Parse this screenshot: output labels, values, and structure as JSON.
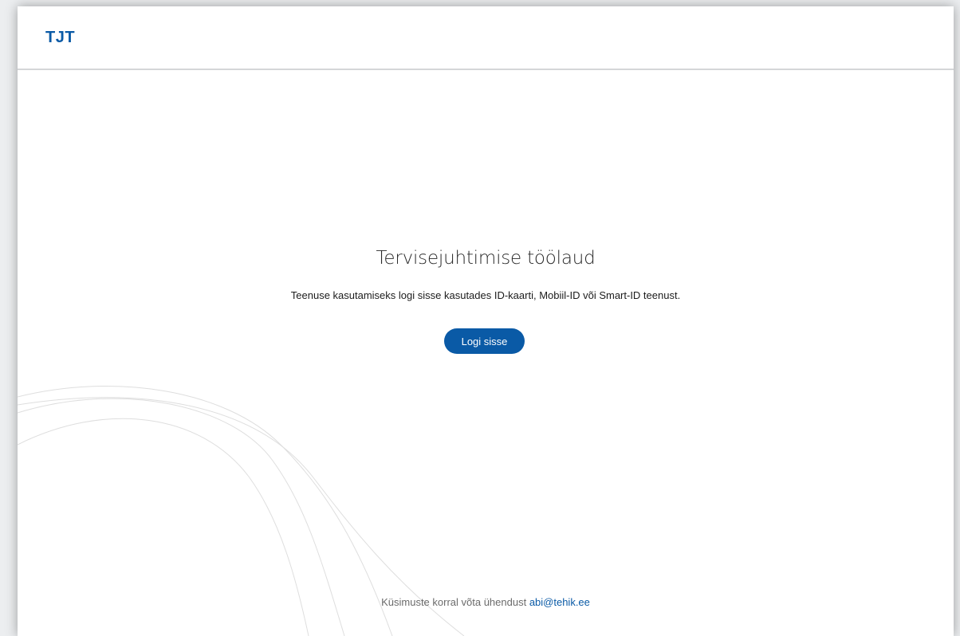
{
  "header": {
    "logo_text": "TJT"
  },
  "main": {
    "title": "Tervisejuhtimise töölaud",
    "subtitle": "Teenuse kasutamiseks logi sisse kasutades ID-kaarti, Mobiil-ID või Smart-ID teenust.",
    "login_label": "Logi sisse"
  },
  "footer": {
    "contact_text": "Küsimuste korral võta ühendust ",
    "contact_email": "abi@tehik.ee"
  },
  "colors": {
    "brand": "#0a5aa6",
    "background": "#ffffff",
    "decorative_lines": "#dcdcdc"
  }
}
